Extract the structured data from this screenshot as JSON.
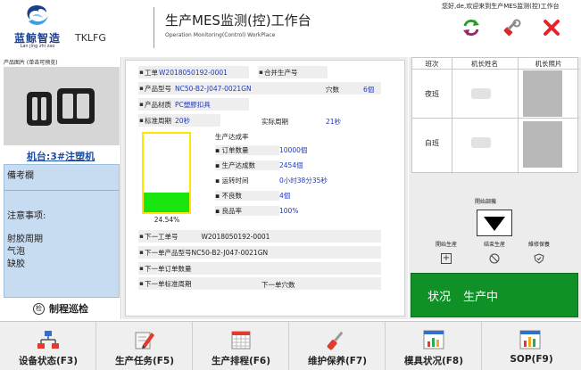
{
  "header": {
    "logo_text": "蓝鲸智造",
    "logo_pinyin": "Lan jing zhi zao",
    "company_code": "TKLFG",
    "title": "生产MES监测(控)工作台",
    "subtitle": "Operation Monitoring(Control) WorkPlace",
    "greeting": "您好,de,欢迎来到生产MES监测(控)工作台",
    "icons": [
      "refresh-icon",
      "wrench-icon",
      "close-icon"
    ]
  },
  "left": {
    "photo_label": "产品图片 (单击可预览)",
    "machine_link": "机台:3#注塑机",
    "notes_title": "備考欄",
    "notes_attention": "注意事项:",
    "defects": [
      "射胶周期",
      "气泡",
      "缺胶"
    ],
    "patrol_icon_char": "检",
    "patrol_label": "制程巡检"
  },
  "center": {
    "work_order_label": "工单",
    "work_order_value": "W2018050192-0001",
    "merge_label": "合并生产号",
    "model_label": "产品型号",
    "model_value": "NC50-B2-J047-0021GN",
    "cavity_label": "穴数",
    "cavity_value": "6個",
    "material_label": "产品材质",
    "material_value": "PC塑膠扣具",
    "std_cycle_label": "标准周期",
    "std_cycle_value": "20秒",
    "actual_cycle_label": "实际周期",
    "actual_cycle_value": "21秒",
    "gauge_percent": 24.54,
    "gauge_text": "24.54%",
    "stats_title": "生产达成率",
    "stats": [
      {
        "label": "订单数量",
        "value": "10000個"
      },
      {
        "label": "生产达成数",
        "value": "2454個"
      },
      {
        "label": "运转时间",
        "value": "0小时38分35秒"
      },
      {
        "label": "不良数",
        "value": "4個"
      },
      {
        "label": "良品率",
        "value": "100%"
      }
    ],
    "next_order_label": "下一工单号",
    "next_order_value": "W2018050192-0001",
    "next_model_label": "下一单产品型号",
    "next_model_value": "NC50-B2-J047-0021GN",
    "next_qty_label": "下一单订单数量",
    "next_cycle_label": "下一单标准周期",
    "next_cavity_label": "下一单穴数"
  },
  "right": {
    "col_shift": "班次",
    "col_name": "机长姓名",
    "col_photo": "机长照片",
    "shifts": [
      "夜班",
      "白班"
    ],
    "center_idle_label": "開始調機",
    "actions": [
      {
        "label": "開始生産",
        "icon": "plus-icon"
      },
      {
        "label": "结束生産",
        "icon": "stop-icon"
      },
      {
        "label": "維修保養",
        "icon": "shield-icon"
      }
    ],
    "status_label": "状况",
    "status_value": "生产中",
    "status_color": "#109128"
  },
  "toolbar": [
    {
      "label": "设备状态(F3)",
      "icon": "network-icon"
    },
    {
      "label": "生产任务(F5)",
      "icon": "pencil-icon"
    },
    {
      "label": "生产排程(F6)",
      "icon": "calendar-icon"
    },
    {
      "label": "维护保养(F7)",
      "icon": "screwdriver-icon"
    },
    {
      "label": "模具状况(F8)",
      "icon": "bar-chart-icon"
    },
    {
      "label": "SOP(F9)",
      "icon": "report-icon"
    }
  ]
}
